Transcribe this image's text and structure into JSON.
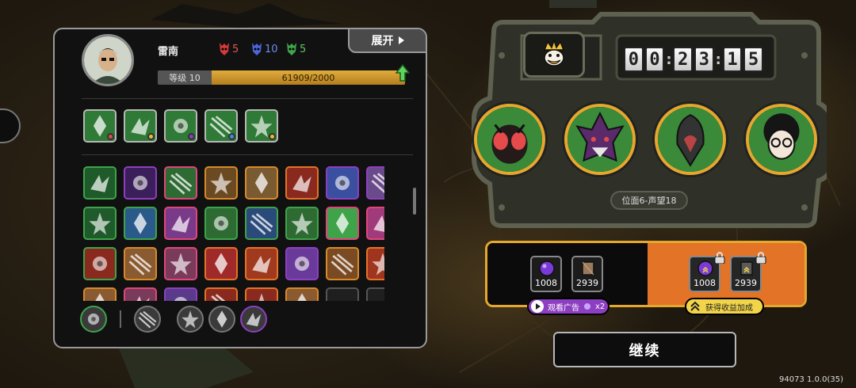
{
  "player": {
    "name": "雷南",
    "level_label": "等级 10",
    "xp_text": "61909/2000",
    "resources": [
      {
        "icon": "red-mask-icon",
        "color": "#d43a3a",
        "value": "5"
      },
      {
        "icon": "blue-mask-icon",
        "color": "#4a66d8",
        "value": "10"
      },
      {
        "icon": "green-mask-icon",
        "color": "#3fa34a",
        "value": "5"
      }
    ]
  },
  "header": {
    "expand_label": "展开"
  },
  "equipped_skills": [
    {
      "icon": "green-leaf-emblem-icon",
      "border": "#b8b8b8",
      "badge": "#e04a4a"
    },
    {
      "icon": "green-vortex-icon",
      "border": "#b8b8b8",
      "badge": "#e0c030"
    },
    {
      "icon": "green-arrow-up-icon",
      "border": "#b8b8b8",
      "badge": "#8d3fc1"
    },
    {
      "icon": "green-dagger-icon",
      "border": "#b8b8b8",
      "badge": "#4a88d8"
    },
    {
      "icon": "green-fan-icon",
      "border": "#b8b8b8",
      "badge": "#e0c030"
    }
  ],
  "skill_grid": [
    {
      "icon": "green-chevron-icon",
      "border": "#3fa34a",
      "bg": "#1f5a2a"
    },
    {
      "icon": "purple-claw-icon",
      "border": "#8d3fc1",
      "bg": "#3a1f5a"
    },
    {
      "icon": "arrows-up-icon",
      "border": "#e0467a",
      "bg": "#2e6b33"
    },
    {
      "icon": "gear-orb-icon",
      "border": "#d88a2a",
      "bg": "#6b4a22"
    },
    {
      "icon": "chain-icon",
      "border": "#d88a2a",
      "bg": "#7a5a30"
    },
    {
      "icon": "demon-face-icon",
      "border": "#e37326",
      "bg": "#8a2a1f"
    },
    {
      "icon": "shield-bolt-icon",
      "border": "#8d3fc1",
      "bg": "#3a4fa0"
    },
    {
      "icon": "shadow-figure-icon",
      "border": "#8d3fc1",
      "bg": "#6a4a8a"
    },
    {
      "icon": "red-arrow-icon",
      "border": "#3fa34a",
      "bg": "#1f5a2a"
    },
    {
      "icon": "blue-slash-icon",
      "border": "#3fa34a",
      "bg": "#2a5a8a"
    },
    {
      "icon": "purple-fist-icon",
      "border": "#e0467a",
      "bg": "#7a3a8a"
    },
    {
      "icon": "green-wave-icon",
      "border": "#3fa34a",
      "bg": "#2e6b33"
    },
    {
      "icon": "blue-whip-icon",
      "border": "#3fa34a",
      "bg": "#2a4a7a"
    },
    {
      "icon": "green-burst-icon",
      "border": "#3fa34a",
      "bg": "#2e6b33"
    },
    {
      "icon": "star-burst-icon",
      "border": "#e0467a",
      "bg": "#3fa34a"
    },
    {
      "icon": "spellbook-icon",
      "border": "#e0467a",
      "bg": "#a03a7a"
    },
    {
      "icon": "red-swirl-icon",
      "border": "#3fa34a",
      "bg": "#8a2a1f"
    },
    {
      "icon": "crate-icon",
      "border": "#d88a2a",
      "bg": "#8a5a30"
    },
    {
      "icon": "pink-sun-icon",
      "border": "#e0467a",
      "bg": "#7a3a5a"
    },
    {
      "icon": "red-lightning-icon",
      "border": "#e37326",
      "bg": "#a02a2a"
    },
    {
      "icon": "orange-blade-icon",
      "border": "#e37326",
      "bg": "#a03a1f"
    },
    {
      "icon": "purple-fiend-icon",
      "border": "#8d3fc1",
      "bg": "#6a3a9a"
    },
    {
      "icon": "golden-strike-icon",
      "border": "#d88a2a",
      "bg": "#7a4a22"
    },
    {
      "icon": "fire-shield-icon",
      "border": "#e37326",
      "bg": "#a0351f"
    },
    {
      "icon": "orange-partial-icon",
      "border": "#d88a2a",
      "bg": "#8a5a30"
    },
    {
      "icon": "pink-partial-icon",
      "border": "#e0467a",
      "bg": "#7a3a5a"
    },
    {
      "icon": "purple-partial-icon",
      "border": "#8d3fc1",
      "bg": "#5a3a8a"
    },
    {
      "icon": "red-partial-icon",
      "border": "#e37326",
      "bg": "#8a2a1f"
    },
    {
      "icon": "red-partial2-icon",
      "border": "#e37326",
      "bg": "#8a2a1f"
    },
    {
      "icon": "orange-partial2-icon",
      "border": "#d88a2a",
      "bg": "#8a5a30"
    },
    {
      "icon": "empty-slot-icon",
      "border": "#555",
      "bg": "#1f1f1f"
    },
    {
      "icon": "empty-slot2-icon",
      "border": "#555",
      "bg": "#1f1f1f"
    }
  ],
  "bottom_icons": [
    {
      "icon": "compass-icon",
      "border": "#3fa34a"
    },
    {
      "icon": "red-blade-icon",
      "border": "#777"
    },
    {
      "icon": "golden-orbs-icon",
      "border": "#777"
    },
    {
      "icon": "grey-ring-icon",
      "border": "#777"
    },
    {
      "icon": "witch-hat-icon",
      "border": "#8d3fc1"
    }
  ],
  "safe": {
    "boss_icon": "crowned-duck-icon",
    "timer_digits": [
      "0",
      "0",
      "2",
      "3",
      "1",
      "5"
    ],
    "rank_label": "位面6-声望18",
    "enemies": [
      {
        "icon": "red-eye-insect-icon"
      },
      {
        "icon": "purple-demon-icon"
      },
      {
        "icon": "hooded-bird-icon"
      },
      {
        "icon": "curly-hair-kid-icon"
      }
    ]
  },
  "rewards": {
    "base": [
      {
        "icon": "purple-orb-icon",
        "count": "1008"
      },
      {
        "icon": "bronze-plate-icon",
        "count": "2939"
      }
    ],
    "boosted": [
      {
        "icon": "purple-orb-boosted-icon",
        "count": "1008"
      },
      {
        "icon": "bronze-plate-boosted-icon",
        "count": "2939"
      }
    ],
    "ad_label": "观看广告",
    "ad_multiplier": "x2",
    "boost_label": "获得收益加成"
  },
  "continue_label": "继续",
  "version": "94073 1.0.0(35)"
}
